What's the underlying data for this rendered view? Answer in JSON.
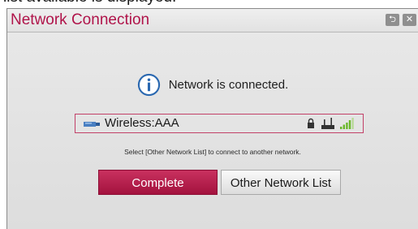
{
  "cropped_top_text": "list available is displayed.",
  "dialog": {
    "title": "Network Connection",
    "back_icon": "back-arrow-icon",
    "close_icon": "close-icon"
  },
  "status": {
    "icon": "info-icon",
    "message": "Network is connected."
  },
  "network": {
    "type_icon": "wireless-adapter-icon",
    "name": "Wireless:AAA",
    "secured_icon": "lock-icon",
    "router_icon": "router-icon",
    "signal_icon": "signal-strength-icon",
    "signal_bars": 4,
    "signal_bars_total": 5
  },
  "hint": "Select [Other Network List] to connect to another network.",
  "buttons": {
    "complete": "Complete",
    "other_network_list": "Other Network List"
  },
  "colors": {
    "accent": "#b0144a",
    "focus_border": "#c24068",
    "signal_green": "#6ab82a"
  }
}
